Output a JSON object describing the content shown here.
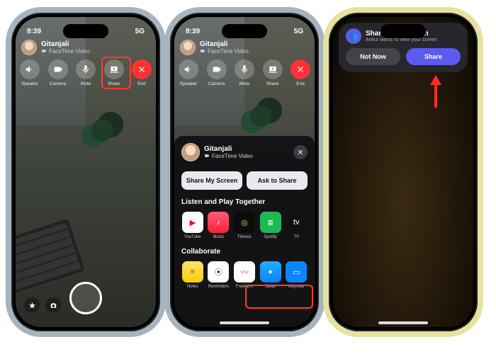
{
  "common": {
    "status_time": "8:39",
    "status_net": "5G",
    "call_name": "Gitanjali",
    "call_sub": "FaceTime Video",
    "ctrl_speaker": "Speaker",
    "ctrl_camera": "Camera",
    "ctrl_mute": "Mute",
    "ctrl_share": "Share",
    "ctrl_end": "End"
  },
  "sheet": {
    "name": "Gitanjali",
    "sub": "FaceTime Video",
    "share_my_screen": "Share My Screen",
    "ask_to_share": "Ask to Share",
    "listen_title": "Listen and Play Together",
    "apps_listen": [
      {
        "label": "YouTube",
        "bg": "#fff",
        "glyph": "▶",
        "fg": "#f00"
      },
      {
        "label": "Music",
        "bg": "linear-gradient(180deg,#fb5c74,#fa233b)",
        "glyph": "♪"
      },
      {
        "label": "Fitness",
        "bg": "#0b0b0b",
        "glyph": "◎",
        "fg": "#a6ff4d"
      },
      {
        "label": "Spotify",
        "bg": "#1db954",
        "glyph": "≣"
      },
      {
        "label": "TV",
        "bg": "#111",
        "glyph": "tv",
        "fg": "#fff"
      }
    ],
    "collab_title": "Collaborate",
    "apps_collab": [
      {
        "label": "Notes",
        "bg": "linear-gradient(180deg,#ffe27a,#ffcc00)",
        "glyph": "≡",
        "fg": "#7a5a00"
      },
      {
        "label": "Reminders",
        "bg": "#fff",
        "glyph": "⦿",
        "fg": "#333"
      },
      {
        "label": "Freeform",
        "bg": "#fff",
        "glyph": "〰",
        "fg": "#f06"
      },
      {
        "label": "Safari",
        "bg": "linear-gradient(180deg,#29a9ff,#0a84ff)",
        "glyph": "✦"
      },
      {
        "label": "Keynote",
        "bg": "#0a84ff",
        "glyph": "▭"
      }
    ]
  },
  "banner": {
    "title": "Share Your Screen",
    "sub": "Ankur wants to view your screen",
    "notnow": "Not Now",
    "share": "Share"
  }
}
